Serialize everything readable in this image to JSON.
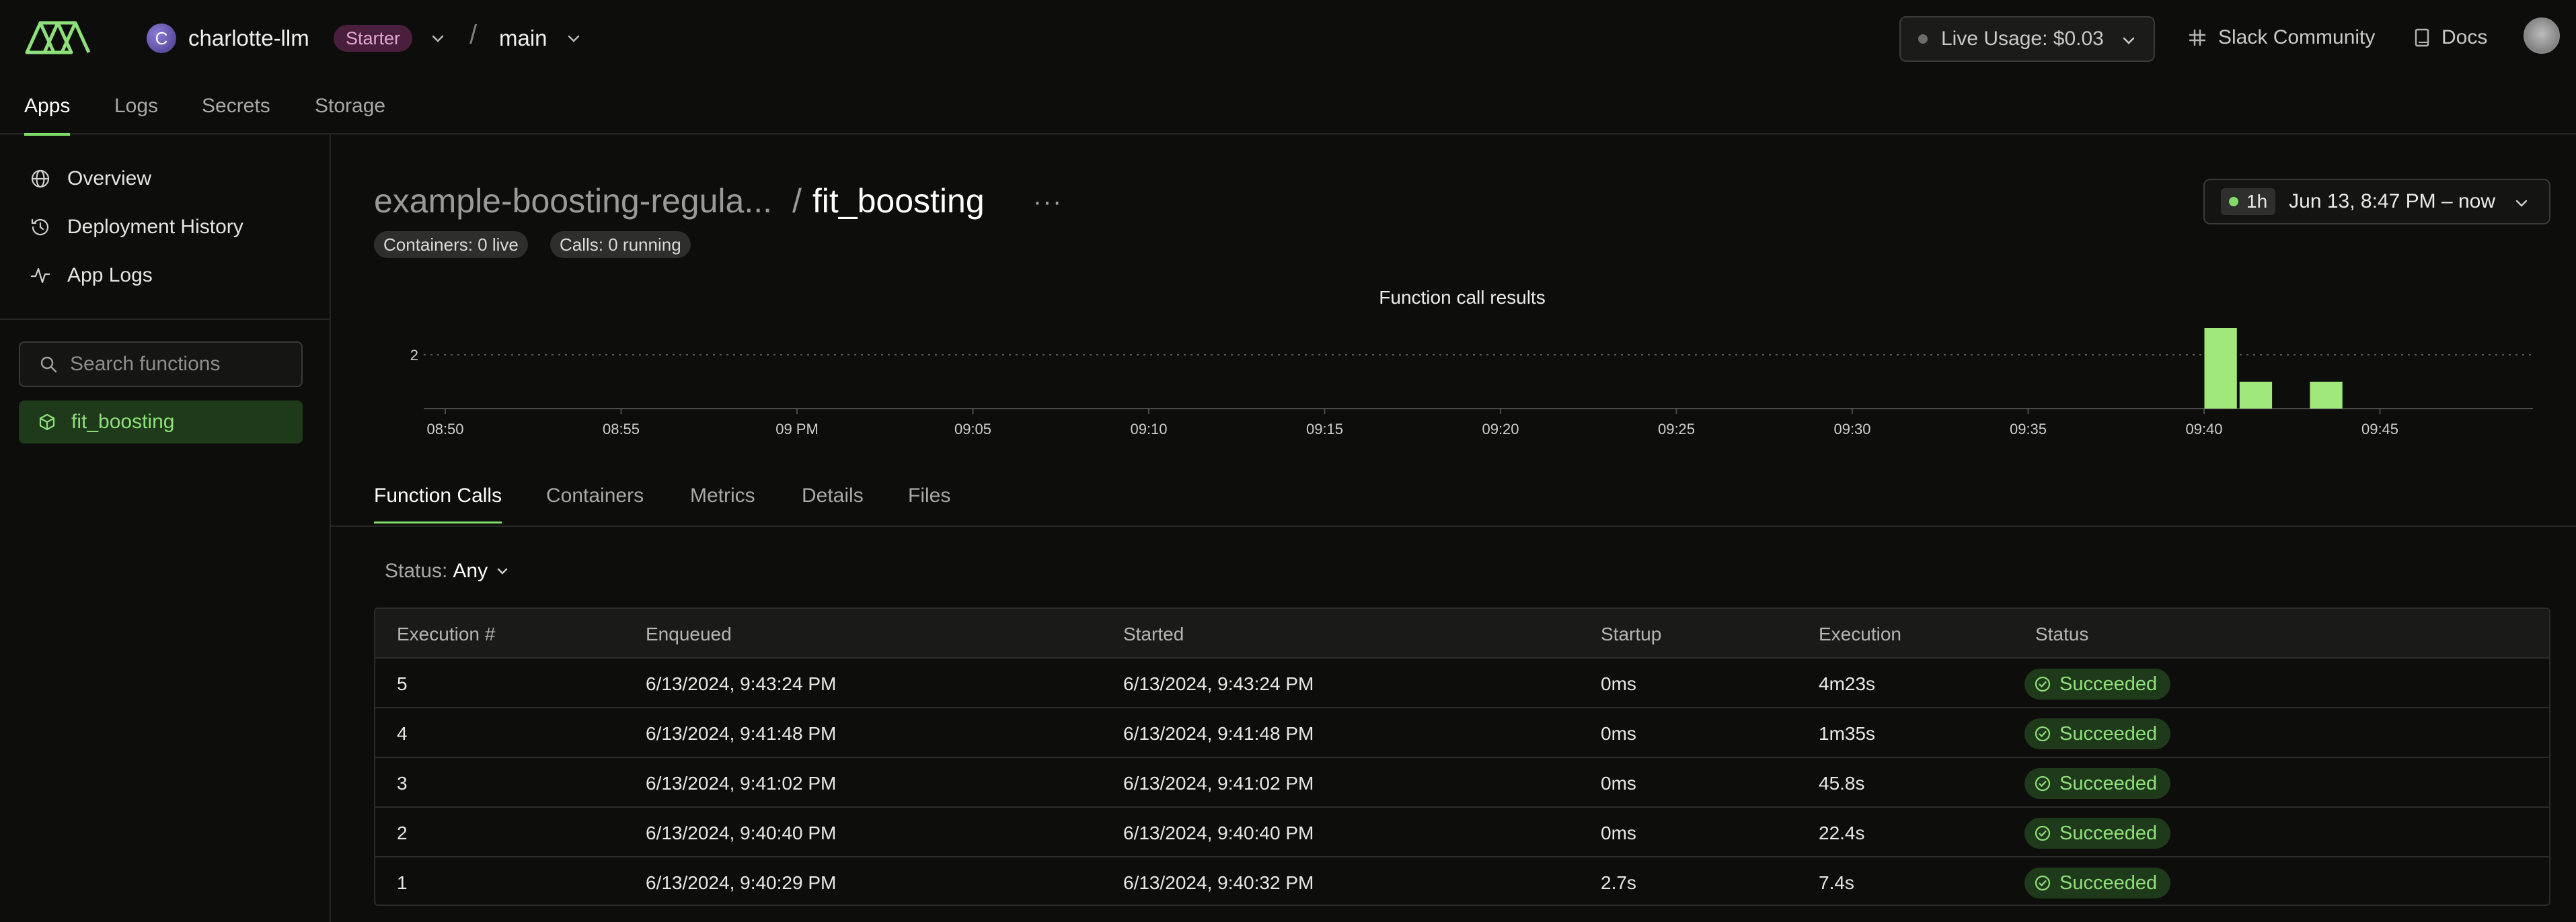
{
  "header": {
    "workspace_initial": "C",
    "workspace_name": "charlotte-llm",
    "plan_badge": "Starter",
    "separator": "/",
    "environment": "main",
    "live_usage": "Live Usage: $0.03",
    "slack": "Slack Community",
    "docs": "Docs"
  },
  "nav": {
    "tabs": [
      "Apps",
      "Logs",
      "Secrets",
      "Storage"
    ],
    "active": "Apps"
  },
  "sidebar": {
    "items": [
      {
        "label": "Overview",
        "icon": "globe-icon"
      },
      {
        "label": "Deployment History",
        "icon": "history-icon"
      },
      {
        "label": "App Logs",
        "icon": "activity-icon"
      }
    ],
    "search_placeholder": "Search functions",
    "functions": [
      "fit_boosting"
    ]
  },
  "page": {
    "app_name": "example-boosting-regula...",
    "separator": "/",
    "function_name": "fit_boosting",
    "more": "···",
    "containers_pill": "Containers: 0 live",
    "calls_pill": "Calls: 0 running",
    "range_chip": "1h",
    "range_text": "Jun 13, 8:47 PM – now"
  },
  "chart_data": {
    "type": "bar",
    "title": "Function call results",
    "y_tick": "2",
    "ylim": [
      0,
      3
    ],
    "x_ticks": [
      "08:50",
      "08:55",
      "09 PM",
      "09:05",
      "09:10",
      "09:15",
      "09:20",
      "09:25",
      "09:30",
      "09:35",
      "09:40",
      "09:45"
    ],
    "bins": [
      "09:40",
      "09:41",
      "09:42",
      "09:43"
    ],
    "series": [
      {
        "values": [
          3,
          1,
          0,
          1
        ]
      }
    ],
    "color": "#a0e87a",
    "grid": true
  },
  "subtabs": {
    "tabs": [
      "Function Calls",
      "Containers",
      "Metrics",
      "Details",
      "Files"
    ],
    "active": "Function Calls"
  },
  "filter": {
    "label": "Status:",
    "value": "Any"
  },
  "table": {
    "columns": [
      "Execution #",
      "Enqueued",
      "Started",
      "Startup",
      "Execution",
      "Status"
    ],
    "rows": [
      {
        "num": "5",
        "enqueued": "6/13/2024, 9:43:24 PM",
        "started": "6/13/2024, 9:43:24 PM",
        "startup": "0ms",
        "execution": "4m23s",
        "status": "Succeeded"
      },
      {
        "num": "4",
        "enqueued": "6/13/2024, 9:41:48 PM",
        "started": "6/13/2024, 9:41:48 PM",
        "startup": "0ms",
        "execution": "1m35s",
        "status": "Succeeded"
      },
      {
        "num": "3",
        "enqueued": "6/13/2024, 9:41:02 PM",
        "started": "6/13/2024, 9:41:02 PM",
        "startup": "0ms",
        "execution": "45.8s",
        "status": "Succeeded"
      },
      {
        "num": "2",
        "enqueued": "6/13/2024, 9:40:40 PM",
        "started": "6/13/2024, 9:40:40 PM",
        "startup": "0ms",
        "execution": "22.4s",
        "status": "Succeeded"
      },
      {
        "num": "1",
        "enqueued": "6/13/2024, 9:40:29 PM",
        "started": "6/13/2024, 9:40:32 PM",
        "startup": "2.7s",
        "execution": "7.4s",
        "status": "Succeeded"
      }
    ]
  },
  "colors": {
    "accent": "#7fdc6a",
    "success_text": "#8ee07a",
    "success_bg": "#1f3a1a",
    "background": "#0d0e0c",
    "plan_badge_bg": "#4a1f3e"
  }
}
